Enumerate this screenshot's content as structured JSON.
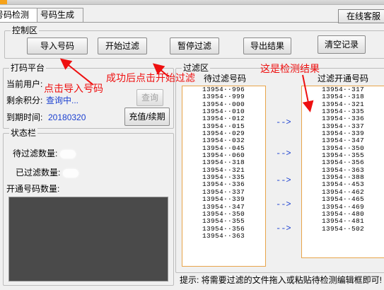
{
  "tabs": [
    "号码检测",
    "号码生成"
  ],
  "online_button": "在线客服",
  "control": {
    "legend": "控制区",
    "buttons": [
      "导入号码",
      "开始过滤",
      "暂停过滤",
      "导出结果",
      "清空记录"
    ]
  },
  "platform": {
    "legend": "打码平台",
    "user_label": "当前用户:",
    "user_value": "",
    "points_label": "剩余积分:",
    "points_value": "查询中...",
    "expire_label": "到期时间:",
    "expire_value": "20180320",
    "query_button": "查询",
    "recharge_button": "充值/续期"
  },
  "status": {
    "legend": "状态栏",
    "pending_label": "待过滤数量:",
    "filtered_label": "已过滤数量:",
    "open_label": "开通号码数量:"
  },
  "filter": {
    "legend": "过滤区",
    "pending_title": "待过滤号码",
    "open_title": "过滤开通号码",
    "arrow": "-->",
    "pending_numbers": [
      "13954··996",
      "13954··999",
      "13954··000",
      "13954··010",
      "13954··012",
      "13954··015",
      "13954··029",
      "13954··032",
      "13954··045",
      "13954··060",
      "13954··318",
      "13954··321",
      "13954··335",
      "13954··336",
      "13954··337",
      "13954··339",
      "13954··347",
      "13954··350",
      "13954··355",
      "13954··356",
      "13954··363"
    ],
    "open_numbers": [
      "13954··317",
      "13954··318",
      "13954··321",
      "13954··335",
      "13954··336",
      "13954··337",
      "13954··339",
      "13954··347",
      "13954··350",
      "13954··355",
      "13954··356",
      "13954··363",
      "13954··388",
      "13954··453",
      "13954··462",
      "13954··465",
      "13954··469",
      "13954··480",
      "13954··481",
      "13954··502"
    ]
  },
  "tip": "提示: 将需要过滤的文件拖入或粘贴待检测编辑框即可!",
  "annotations": {
    "click_import": "点击导入号码",
    "after_success": "成功后点击开始过滤",
    "result_here": "这是检测结果"
  }
}
